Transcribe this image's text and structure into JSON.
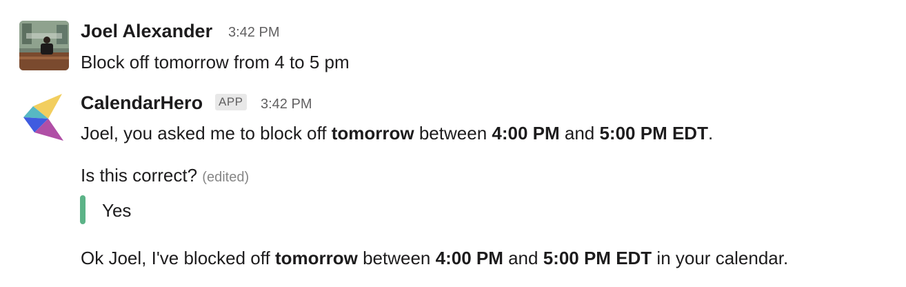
{
  "messages": [
    {
      "author": "Joel Alexander",
      "time": "3:42 PM",
      "text": "Block off tomorrow from 4 to 5 pm"
    },
    {
      "author": "CalendarHero",
      "badge": "APP",
      "time": "3:42 PM",
      "line1": {
        "p1": "Joel, you asked me to block off ",
        "b1": "tomorrow",
        "p2": " between ",
        "b2": "4:00 PM",
        "p3": " and ",
        "b3": "5:00 PM EDT",
        "p4": "."
      },
      "question": "Is this correct?",
      "edited": "(edited)",
      "reply": "Yes",
      "line2": {
        "p1": "Ok Joel, I've blocked off ",
        "b1": "tomorrow",
        "p2": " between ",
        "b2": "4:00 PM",
        "p3": " and ",
        "b3": "5:00 PM EDT",
        "p4": " in your calendar."
      }
    }
  ],
  "colors": {
    "quote_bar": "#5cb387",
    "logo_yellow": "#f2ce5e",
    "logo_teal": "#57b8c3",
    "logo_blue": "#3f5be0",
    "logo_purple": "#b04fa6"
  },
  "icons": {
    "user_avatar": "user-photo-avatar",
    "app_avatar": "calendarhero-logo"
  }
}
